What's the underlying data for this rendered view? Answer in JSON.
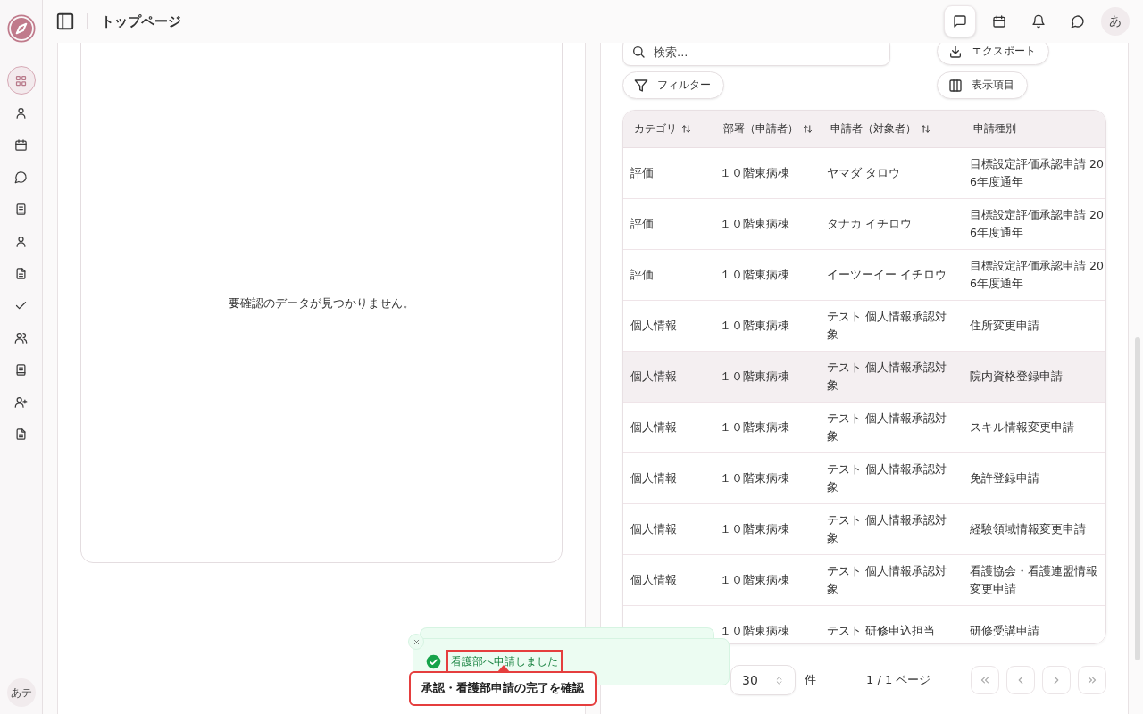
{
  "sidebar": {
    "items": [
      {
        "kind": "grid",
        "selected": true
      },
      {
        "kind": "user",
        "selected": false
      },
      {
        "kind": "calendar",
        "selected": false
      },
      {
        "kind": "chat",
        "selected": false
      },
      {
        "kind": "book",
        "selected": false
      },
      {
        "kind": "user",
        "selected": false
      },
      {
        "kind": "file",
        "selected": false
      },
      {
        "kind": "check",
        "selected": false
      },
      {
        "kind": "users",
        "selected": false
      },
      {
        "kind": "book",
        "selected": false
      },
      {
        "kind": "user-plus",
        "selected": false
      },
      {
        "kind": "file",
        "selected": false
      }
    ],
    "user_initials": "あテ"
  },
  "header": {
    "title": "トップページ",
    "actions": [
      {
        "kind": "message",
        "selected": true
      },
      {
        "kind": "calendar",
        "selected": false
      },
      {
        "kind": "bell",
        "selected": false
      },
      {
        "kind": "chat",
        "selected": false
      }
    ],
    "avatar": "あ"
  },
  "left_panel": {
    "empty_message": "要確認のデータが見つかりません。"
  },
  "right_panel": {
    "search": {
      "placeholder": "検索..."
    },
    "export_button": "エクスポート",
    "filter_button": "フィルター",
    "columns_button": "表示項目",
    "table": {
      "columns": [
        {
          "label": "カテゴリ",
          "sortable": true
        },
        {
          "label": "部署（申請者）",
          "sortable": true
        },
        {
          "label": "申請者（対象者）",
          "sortable": true
        },
        {
          "label": "申請種別",
          "sortable": false
        }
      ],
      "rows": [
        {
          "category": "評価",
          "department": "１０階東病棟",
          "applicant": "ヤマダ タロウ",
          "type": "目標設定評価承認申請 20\n6年度通年",
          "selected": false
        },
        {
          "category": "評価",
          "department": "１０階東病棟",
          "applicant": "タナカ イチロウ",
          "type": "目標設定評価承認申請 20\n6年度通年",
          "selected": false
        },
        {
          "category": "評価",
          "department": "１０階東病棟",
          "applicant": "イーツーイー イチロウ",
          "type": "目標設定評価承認申請 20\n6年度通年",
          "selected": false
        },
        {
          "category": "個人情報",
          "department": "１０階東病棟",
          "applicant": "テスト 個人情報承認対象",
          "type": "住所変更申請",
          "selected": false
        },
        {
          "category": "個人情報",
          "department": "１０階東病棟",
          "applicant": "テスト 個人情報承認対象",
          "type": "院内資格登録申請",
          "selected": true
        },
        {
          "category": "個人情報",
          "department": "１０階東病棟",
          "applicant": "テスト 個人情報承認対象",
          "type": "スキル情報変更申請",
          "selected": false
        },
        {
          "category": "個人情報",
          "department": "１０階東病棟",
          "applicant": "テスト 個人情報承認対象",
          "type": "免許登録申請",
          "selected": false
        },
        {
          "category": "個人情報",
          "department": "１０階東病棟",
          "applicant": "テスト 個人情報承認対象",
          "type": "経験領域情報変更申請",
          "selected": false
        },
        {
          "category": "個人情報",
          "department": "１０階東病棟",
          "applicant": "テスト 個人情報承認対象",
          "type": "看護協会・看護連盟情報変更申請",
          "selected": false
        },
        {
          "department": "１０階東病棟",
          "applicant": "テスト 研修申込担当",
          "type": "研修受講申請",
          "selected": false
        }
      ]
    },
    "pagination": {
      "page_size": "30",
      "unit": "件",
      "page_info": "1 / 1 ページ",
      "buttons": [
        {
          "kind": "first",
          "disabled": true
        },
        {
          "kind": "prev",
          "disabled": true
        },
        {
          "kind": "next",
          "disabled": true
        },
        {
          "kind": "last",
          "disabled": true
        }
      ]
    }
  },
  "toast": {
    "message": "看護部へ申請しました",
    "highlighted": true
  },
  "callout": {
    "text": "承認・看護部申請の完了を確認"
  }
}
